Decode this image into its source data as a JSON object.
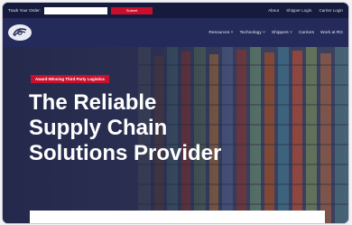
{
  "topbar": {
    "track_label": "Track Your Order:",
    "track_value": "",
    "submit_label": "Submit",
    "links": [
      "About",
      "Shipper Login",
      "Carrier Login"
    ]
  },
  "navbar": {
    "logo_text": "",
    "links": [
      "Resources ˅",
      "Technology ˅",
      "Shippers ˅",
      "Carriers",
      "Work at RG"
    ]
  },
  "hero": {
    "badge": "Award-Winning Third Party Logistics",
    "headline": [
      "The Reliable",
      "Supply Chain",
      "Solutions Provider"
    ]
  },
  "colors": {
    "navy": "#242a5a",
    "topbar": "#161a3c",
    "accent_red": "#c8102e"
  },
  "icons": {
    "logo": "rg-logo-icon"
  }
}
